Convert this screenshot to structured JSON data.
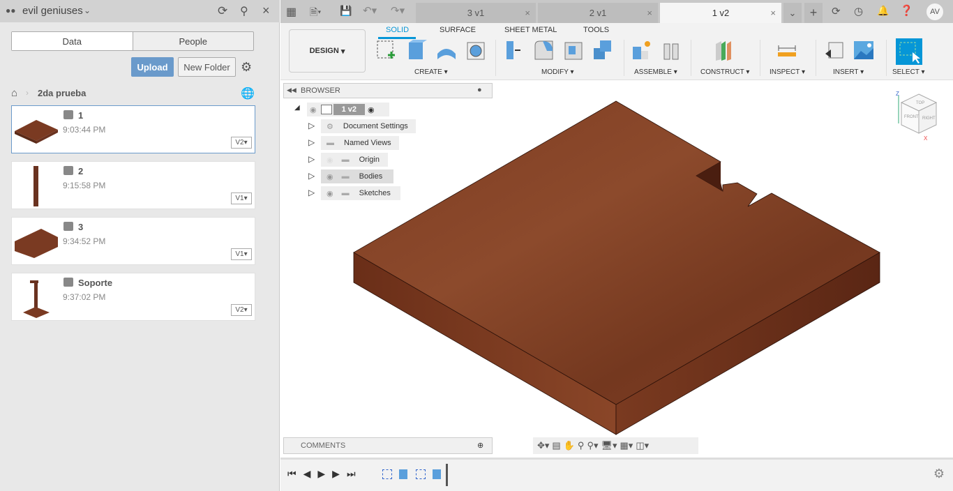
{
  "data_panel": {
    "team": "evil geniuses",
    "tabs": [
      "Data",
      "People"
    ],
    "upload": "Upload",
    "new_folder": "New Folder",
    "breadcrumb": "2da prueba",
    "files": [
      {
        "name": "1",
        "time": "9:03:44 PM",
        "version": "V2"
      },
      {
        "name": "2",
        "time": "9:15:58 PM",
        "version": "V1"
      },
      {
        "name": "3",
        "time": "9:34:52 PM",
        "version": "V1"
      },
      {
        "name": "Soporte",
        "time": "9:37:02 PM",
        "version": "V2"
      }
    ]
  },
  "doc_tabs": [
    {
      "label": "3 v1"
    },
    {
      "label": "2 v1"
    },
    {
      "label": "1 v2",
      "active": true
    }
  ],
  "user_initials": "AV",
  "ribbon": {
    "workspace": "DESIGN",
    "tabs": [
      "SOLID",
      "SURFACE",
      "SHEET METAL",
      "TOOLS"
    ],
    "groups": [
      "CREATE",
      "MODIFY",
      "ASSEMBLE",
      "CONSTRUCT",
      "INSPECT",
      "INSERT",
      "SELECT"
    ],
    "accent": "#0696d7"
  },
  "browser": {
    "title": "BROWSER",
    "root": "1 v2",
    "items": [
      "Document Settings",
      "Named Views",
      "Origin",
      "Bodies",
      "Sketches"
    ]
  },
  "comments": {
    "title": "COMMENTS"
  },
  "viewcube": {
    "faces": [
      "TOP",
      "FRONT",
      "RIGHT"
    ],
    "axes": [
      "Z",
      "X"
    ]
  },
  "model_color": "#7a3a22"
}
